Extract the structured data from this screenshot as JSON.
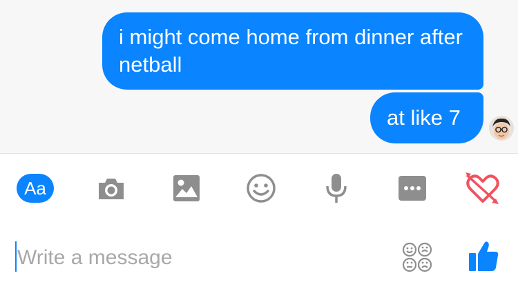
{
  "thread": {
    "messages": [
      {
        "text": "i might come home from dinner after netball",
        "sender": "me"
      },
      {
        "text": "at like 7",
        "sender": "me"
      }
    ]
  },
  "toolbar": {
    "format_label": "Aa",
    "icons": [
      "camera-icon",
      "image-icon",
      "emoji-icon",
      "microphone-icon",
      "more-icon",
      "heart-arrow-icon"
    ]
  },
  "composer": {
    "placeholder": "Write a message",
    "value": ""
  },
  "colors": {
    "accent": "#0a84ff",
    "icon_gray": "#8e8e8e",
    "heart_red": "#f0525e",
    "thread_bg": "#f7f7f7"
  }
}
